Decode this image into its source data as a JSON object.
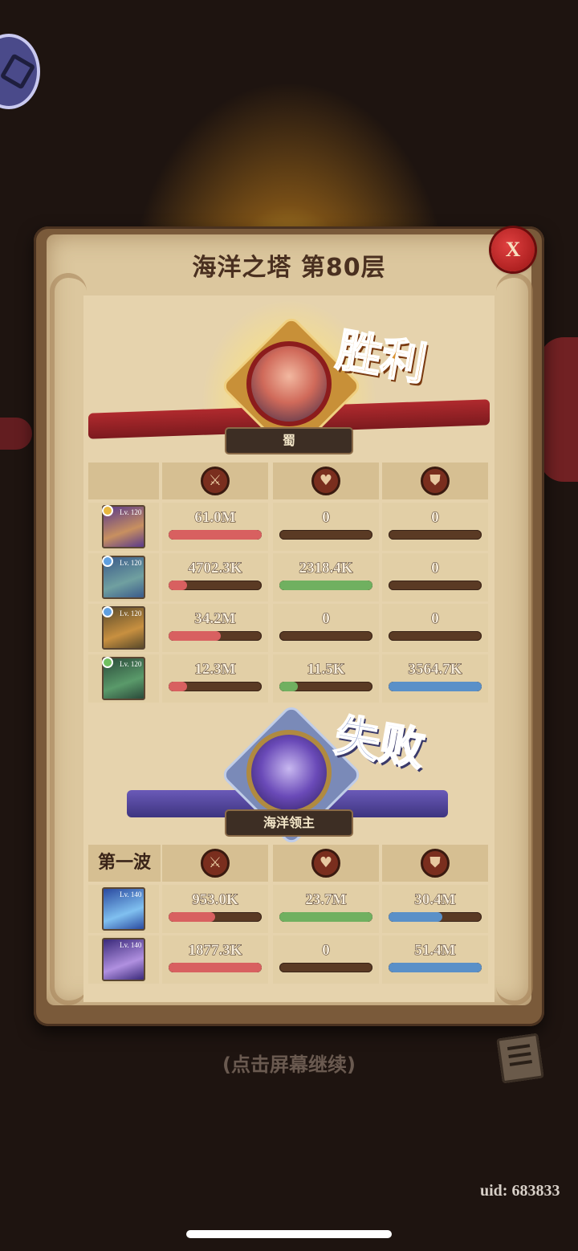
{
  "title": "海洋之塔 第80层",
  "close_label": "X",
  "victory": {
    "result_label": "胜利",
    "team_name": "蜀",
    "heroes": [
      {
        "level": "Lv. 120",
        "star_color": "#e8b840",
        "portrait": [
          "#5a3a8a",
          "#c89060"
        ],
        "stats": [
          {
            "value": "61.0M",
            "fill": 1.0
          },
          {
            "value": "0",
            "fill": 0
          },
          {
            "value": "0",
            "fill": 0
          }
        ]
      },
      {
        "level": "Lv. 120",
        "star_color": "#60a0e0",
        "portrait": [
          "#3a5a8a",
          "#70a0a0"
        ],
        "stats": [
          {
            "value": "4702.3K",
            "fill": 0.2
          },
          {
            "value": "2318.4K",
            "fill": 1.0
          },
          {
            "value": "0",
            "fill": 0
          }
        ]
      },
      {
        "level": "Lv. 120",
        "star_color": "#60a0e0",
        "portrait": [
          "#5a4a2a",
          "#c89040"
        ],
        "stats": [
          {
            "value": "34.2M",
            "fill": 0.56
          },
          {
            "value": "0",
            "fill": 0
          },
          {
            "value": "0",
            "fill": 0
          }
        ]
      },
      {
        "level": "Lv. 120",
        "star_color": "#70c060",
        "portrait": [
          "#2a4a3a",
          "#5a9a6a"
        ],
        "stats": [
          {
            "value": "12.3M",
            "fill": 0.2
          },
          {
            "value": "11.5K",
            "fill": 0.2
          },
          {
            "value": "3564.7K",
            "fill": 1.0
          }
        ]
      }
    ]
  },
  "defeat": {
    "result_label": "失败",
    "team_name": "海洋领主",
    "wave_label": "第一波",
    "enemies": [
      {
        "level": "Lv. 140",
        "portrait": [
          "#2a4aa0",
          "#80c0f0"
        ],
        "stats": [
          {
            "value": "953.0K",
            "fill": 0.5
          },
          {
            "value": "23.7M",
            "fill": 1.0
          },
          {
            "value": "30.4M",
            "fill": 0.58
          }
        ]
      },
      {
        "level": "Lv. 140",
        "portrait": [
          "#3a2a7a",
          "#b090e0"
        ],
        "stats": [
          {
            "value": "1877.3K",
            "fill": 1.0
          },
          {
            "value": "0",
            "fill": 0
          },
          {
            "value": "51.4M",
            "fill": 1.0
          }
        ]
      }
    ]
  },
  "column_icons": [
    "sword-icon",
    "heart-icon",
    "shield-icon"
  ],
  "colors": {
    "damage": "#d86060",
    "heal": "#70b060",
    "shield": "#5a90c8"
  },
  "continue_hint": "(点击屏幕继续)",
  "uid": "uid: 683833"
}
